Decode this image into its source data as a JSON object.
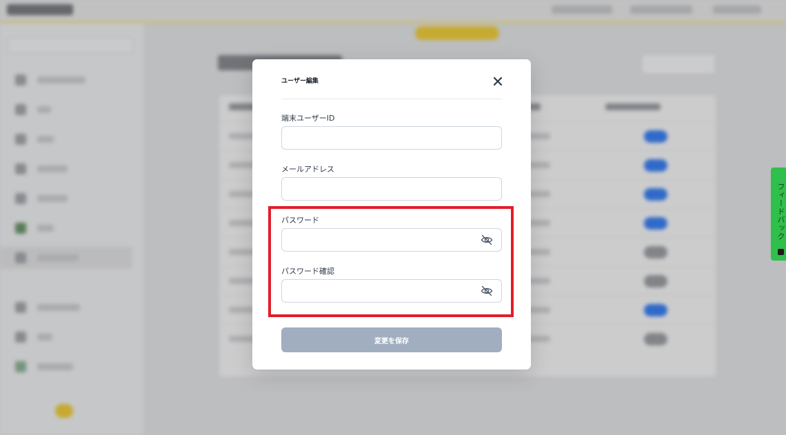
{
  "modal": {
    "title": "ユーザー編集",
    "close_icon": "close-icon",
    "fields": {
      "user_id": {
        "label": "端末ユーザーID",
        "value": "",
        "placeholder": ""
      },
      "email": {
        "label": "メールアドレス",
        "value": "",
        "placeholder": ""
      },
      "password": {
        "label": "パスワード",
        "value": "",
        "placeholder": "",
        "icon": "eye-off-icon"
      },
      "password_confirm": {
        "label": "パスワード確認",
        "value": "",
        "placeholder": "",
        "icon": "eye-off-icon"
      }
    },
    "save_label": "変更を保存"
  },
  "feedback_tab": {
    "label": "フィードバック",
    "icon": "feedback-icon"
  },
  "colors": {
    "highlight": "#e11d2a",
    "save_button_disabled": "#a0aec0",
    "feedback_tab": "#2fbf4a",
    "accent_yellow": "#f2d13d",
    "toggle_on": "#3b82f6"
  },
  "background_state": {
    "blurred": true,
    "table_toggles": [
      "on",
      "on",
      "on",
      "on",
      "off",
      "off",
      "on",
      "off"
    ]
  }
}
